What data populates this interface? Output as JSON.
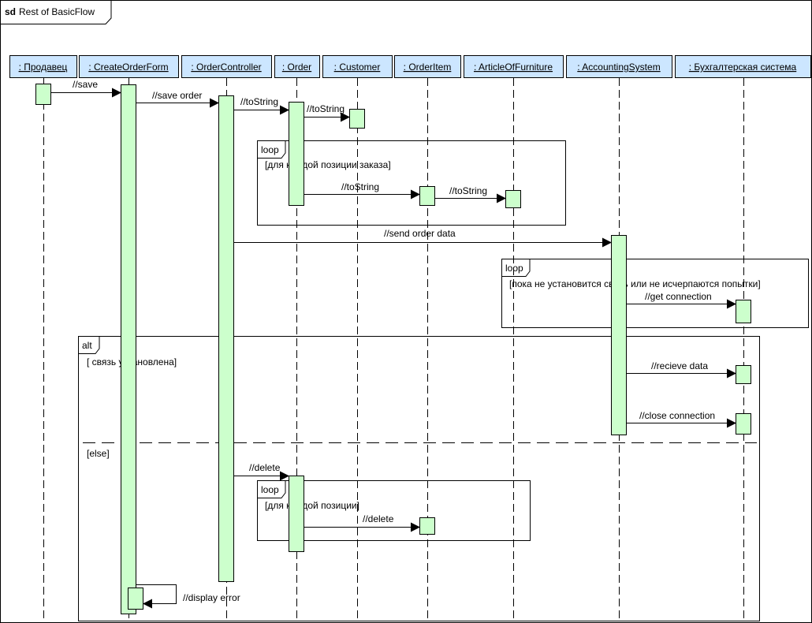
{
  "frame": {
    "keyword": "sd",
    "title": "Rest of BasicFlow"
  },
  "colors": {
    "header_fill": "#cce6ff",
    "activation_fill": "#ccffcc",
    "line": "#000000"
  },
  "lifelines": [
    {
      "id": "prodavets",
      "label": ":  Продавец"
    },
    {
      "id": "createorderform",
      "label": ":  CreateOrderForm"
    },
    {
      "id": "ordercontroller",
      "label": ":  OrderController"
    },
    {
      "id": "order",
      "label": ":  Order"
    },
    {
      "id": "customer",
      "label": ":  Customer"
    },
    {
      "id": "orderitem",
      "label": ":  OrderItem"
    },
    {
      "id": "articleoffurniture",
      "label": ":  ArticleOfFurniture"
    },
    {
      "id": "accountingsystem",
      "label": ":  AccountingSystem"
    },
    {
      "id": "buhsystem",
      "label": ":  Бухгалтерская система"
    }
  ],
  "messages": [
    {
      "label": "//save",
      "from": "prodavets",
      "to": "createorderform"
    },
    {
      "label": "//save order",
      "from": "createorderform",
      "to": "ordercontroller"
    },
    {
      "label": "//toString",
      "from": "ordercontroller",
      "to": "order"
    },
    {
      "label": "//toString",
      "from": "order",
      "to": "customer"
    },
    {
      "label": "//toString",
      "from": "order",
      "to": "orderitem"
    },
    {
      "label": "//toString",
      "from": "orderitem",
      "to": "articleoffurniture"
    },
    {
      "label": "//send order data",
      "from": "ordercontroller",
      "to": "accountingsystem"
    },
    {
      "label": "//get connection",
      "from": "accountingsystem",
      "to": "buhsystem"
    },
    {
      "label": "//recieve data",
      "from": "accountingsystem",
      "to": "buhsystem"
    },
    {
      "label": "//close connection",
      "from": "accountingsystem",
      "to": "buhsystem"
    },
    {
      "label": "//delete",
      "from": "ordercontroller",
      "to": "order"
    },
    {
      "label": "//delete",
      "from": "order",
      "to": "orderitem"
    },
    {
      "label": "//display error",
      "from": "createorderform",
      "to": "createorderform"
    }
  ],
  "fragments": [
    {
      "operator": "loop",
      "guard": "[для каждой позиции заказа]"
    },
    {
      "operator": "loop",
      "guard": "[пока не установится связь или не исчерпаются попытки]"
    },
    {
      "operator": "alt",
      "guard": "[ связь установлена]",
      "else_guard": "[else]"
    },
    {
      "operator": "loop",
      "guard": "[для каждой позиции]"
    }
  ]
}
